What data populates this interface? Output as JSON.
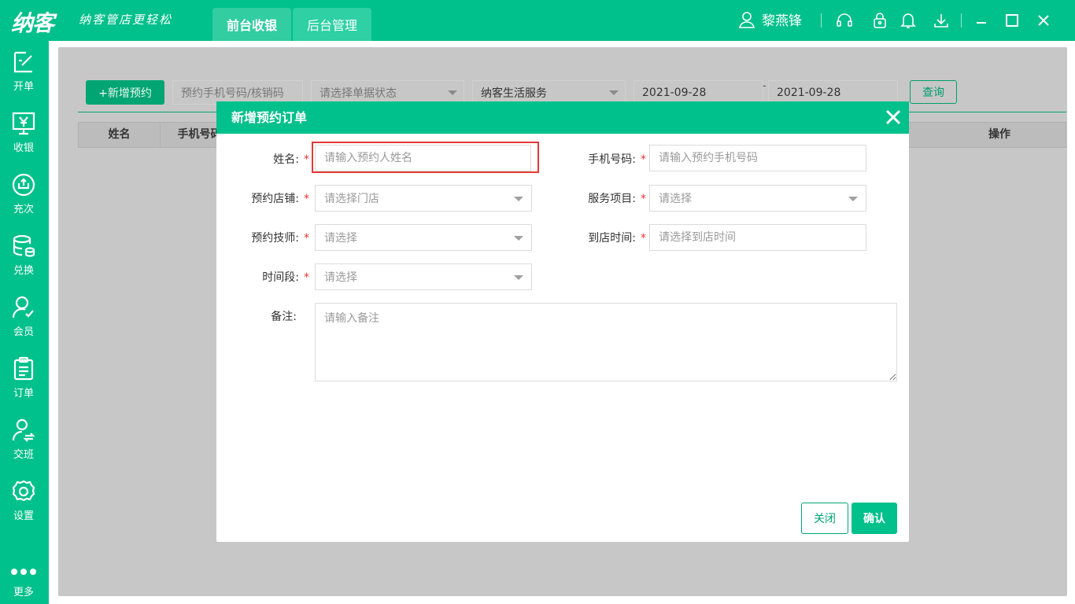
{
  "app": {
    "logo": "纳客",
    "slogan": "纳客管店更轻松",
    "tabs": [
      {
        "label": "前台收银",
        "active": true
      },
      {
        "label": "后台管理",
        "active": false
      }
    ],
    "user_name": "黎燕锋",
    "brand_color": "#00c08b"
  },
  "sidebar": {
    "items": [
      {
        "label": "开单",
        "icon": "edit-icon"
      },
      {
        "label": "收银",
        "icon": "cashier-icon"
      },
      {
        "label": "充次",
        "icon": "recharge-icon"
      },
      {
        "label": "兑换",
        "icon": "database-icon"
      },
      {
        "label": "会员",
        "icon": "member-icon"
      },
      {
        "label": "订单",
        "icon": "clipboard-icon"
      },
      {
        "label": "交班",
        "icon": "handover-icon"
      },
      {
        "label": "设置",
        "icon": "gear-icon"
      },
      {
        "label": "更多",
        "icon": "more-icon"
      }
    ]
  },
  "toolbar": {
    "new_button": "+新增预约",
    "search_placeholder": "预约手机号码/核销码",
    "status_placeholder": "请选择单据状态",
    "store_value": "纳客生活服务",
    "date_from": "2021-09-28",
    "date_sep": "-",
    "date_to": "2021-09-28",
    "query_button": "查询"
  },
  "table": {
    "columns": [
      "姓名",
      "手机号码",
      "操作"
    ]
  },
  "modal": {
    "title": "新增预约订单",
    "fields": {
      "name_label": "姓名:",
      "name_placeholder": "请输入预约人姓名",
      "phone_label": "手机号码:",
      "phone_placeholder": "请输入预约手机号码",
      "store_label": "预约店铺:",
      "store_placeholder": "请选择门店",
      "service_label": "服务项目:",
      "service_placeholder": "请选择",
      "tech_label": "预约技师:",
      "tech_placeholder": "请选择",
      "arrive_label": "到店时间:",
      "arrive_placeholder": "请选择到店时间",
      "slot_label": "时间段:",
      "slot_placeholder": "请选择",
      "note_label": "备注:",
      "note_placeholder": "请输入备注",
      "required_mark": "*"
    },
    "buttons": {
      "close": "关闭",
      "confirm": "确认"
    }
  }
}
